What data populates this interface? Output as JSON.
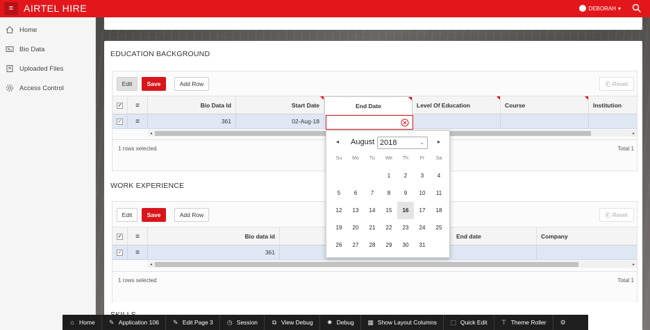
{
  "app": {
    "title": "AIRTEL HIRE",
    "user": "DEBORAH",
    "accent": "#e3171b"
  },
  "sidebar": {
    "items": [
      {
        "label": "Home",
        "icon": "home-icon"
      },
      {
        "label": "Bio Data",
        "icon": "id-card-icon"
      },
      {
        "label": "Uploaded Files",
        "icon": "file-icon"
      },
      {
        "label": "Access Control",
        "icon": "gear-icon"
      }
    ]
  },
  "education": {
    "title": "EDUCATION BACKGROUND",
    "toolbar": {
      "edit": "Edit",
      "save": "Save",
      "add_row": "Add Row",
      "reset": "Reset"
    },
    "columns": [
      "Bio Data Id",
      "Start Date",
      "End Date",
      "Level Of Education",
      "Course",
      "Institution"
    ],
    "row": {
      "bio_data_id": "361",
      "start_date": "02-Aug-18",
      "end_date": ""
    },
    "footer": {
      "selected": "1 rows selected",
      "total": "Total 1"
    }
  },
  "datepicker": {
    "month": "August",
    "year": "2018",
    "weekdays": [
      "Su",
      "Mo",
      "Tu",
      "We",
      "Th",
      "Fr",
      "Sa"
    ],
    "days": [
      "1",
      "2",
      "3",
      "4",
      "5",
      "6",
      "7",
      "8",
      "9",
      "10",
      "11",
      "12",
      "13",
      "14",
      "15",
      "16",
      "17",
      "18",
      "19",
      "20",
      "21",
      "22",
      "23",
      "24",
      "25",
      "26",
      "27",
      "28",
      "29",
      "30",
      "31"
    ],
    "today": "16"
  },
  "work": {
    "title": "WORK EXPERIENCE",
    "toolbar": {
      "edit": "Edit",
      "save": "Save",
      "add_row": "Add Row",
      "reset": "Reset"
    },
    "columns": [
      "Bio data id",
      "End date",
      "Company"
    ],
    "row": {
      "bio_data_id": "361"
    },
    "footer": {
      "selected": "1 rows selected",
      "total": "Total 1"
    }
  },
  "skills": {
    "title": "SKILLS"
  },
  "devbar": {
    "items": [
      {
        "label": "Home",
        "icon": "home-icon"
      },
      {
        "label": "Application 106",
        "icon": "edit-icon"
      },
      {
        "label": "Edit Page 3",
        "icon": "edit-icon"
      },
      {
        "label": "Session",
        "icon": "clock-icon"
      },
      {
        "label": "View Debug",
        "icon": "window-icon"
      },
      {
        "label": "Debug",
        "icon": "bug-icon"
      },
      {
        "label": "Show Layout Columns",
        "icon": "grid-icon"
      },
      {
        "label": "Quick Edit",
        "icon": "cursor-icon"
      },
      {
        "label": "Theme Roller",
        "icon": "paint-roller-icon"
      },
      {
        "label": "",
        "icon": "gear-icon"
      }
    ]
  }
}
